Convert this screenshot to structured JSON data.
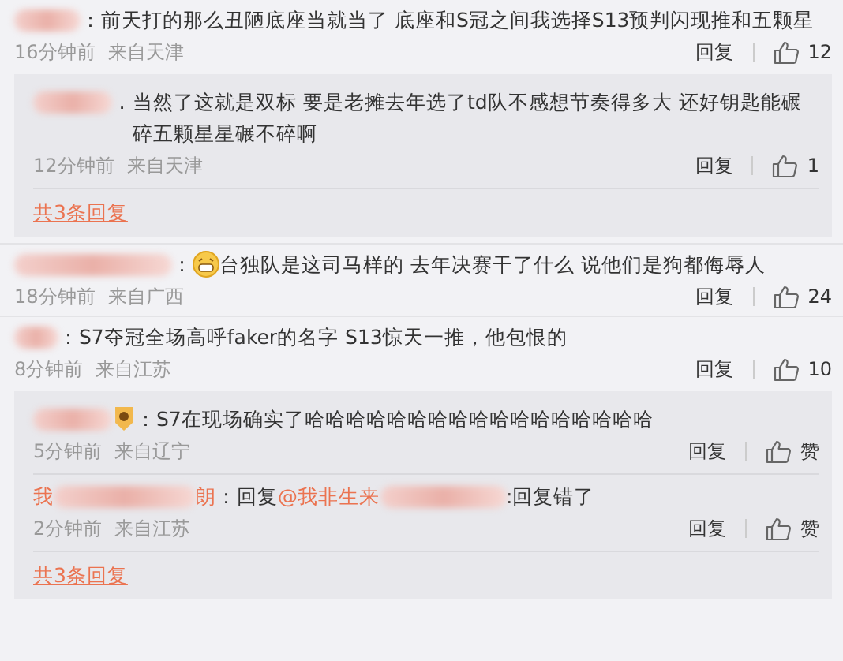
{
  "comments": [
    {
      "sep": "：",
      "text": "前天打的那么丑陋底座当就当了 底座和S冠之间我选择S13预判闪现推和五颗星",
      "time": "16分钟前",
      "location": "来自天津",
      "reply_label": "回复",
      "likes": "12",
      "replies": [
        {
          "sep": "．",
          "text": "当然了这就是双标 要是老摊去年选了td队不感想节奏得多大 还好钥匙能碾碎五颗星星碾不碎啊",
          "time": "12分钟前",
          "location": "来自天津",
          "reply_label": "回复",
          "likes": "1"
        }
      ],
      "more": "共3条回复"
    },
    {
      "kind": "grin",
      "sep": "：",
      "text": "台独队是这司马样的 去年决赛干了什么 说他们是狗都侮辱人",
      "time": "18分钟前",
      "location": "来自广西",
      "reply_label": "回复",
      "likes": "24"
    },
    {
      "sep": "：",
      "text": "S7夺冠全场高呼faker的名字 S13惊天一推，他包恨的",
      "time": "8分钟前",
      "location": "来自江苏",
      "reply_label": "回复",
      "likes": "10",
      "replies": [
        {
          "kind": "badge",
          "sep": "：",
          "text": "S7在现场确实了哈哈哈哈哈哈哈哈哈哈哈哈哈哈哈哈哈",
          "time": "5分钟前",
          "location": "来自辽宁",
          "reply_label": "回复",
          "likes": "赞"
        },
        {
          "name_start": "我",
          "name_end": "朗",
          "sep": "：",
          "reply_word": "回复",
          "mention": "@我非生来",
          "text": ":回复错了",
          "time": "2分钟前",
          "location": "来自江苏",
          "reply_label": "回复",
          "likes": "赞"
        }
      ],
      "more": "共3条回复"
    }
  ]
}
